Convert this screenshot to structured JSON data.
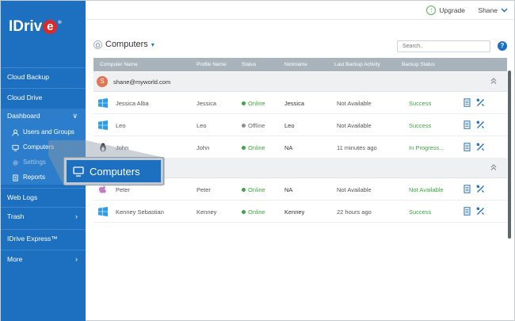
{
  "brand": {
    "logo_text": "IDriv",
    "logo_e": "e",
    "logo_mark": "®"
  },
  "topbar": {
    "upgrade_label": "Upgrade",
    "user_name": "Shane"
  },
  "sidebar": {
    "cloud_backup": "Cloud Backup",
    "cloud_drive": "Cloud Drive",
    "dashboard": "Dashboard",
    "dashboard_items": {
      "users": "Users and Groups",
      "computers": "Computers",
      "settings": "Settings",
      "reports": "Reports"
    },
    "web_logs": "Web Logs",
    "trash": "Trash",
    "express": "IDrive Express™",
    "more": "More"
  },
  "page": {
    "title": "Computers",
    "search_placeholder": "Search..",
    "help": "?"
  },
  "table": {
    "headers": {
      "computer": "Computer Name",
      "profile": "Profile Name",
      "status": "Status",
      "nickname": "Nickname",
      "last": "Last Backup Activity",
      "backup": "Backup Status"
    },
    "groups": [
      {
        "avatar": "S",
        "email": "shane@myworld.com"
      },
      {
        "avatar": "",
        "email": ""
      }
    ],
    "rows": [
      {
        "os": "windows",
        "name": "Jessica Alba",
        "profile": "Jessica",
        "status": "Online",
        "nickname": "Jessica",
        "last": "Not Available",
        "backup": "Success"
      },
      {
        "os": "windows",
        "name": "Leo",
        "profile": "Leo",
        "status": "Offline",
        "nickname": "Leo",
        "last": "Not Available",
        "backup": "Success"
      },
      {
        "os": "linux",
        "name": "John",
        "profile": "John",
        "status": "Online",
        "nickname": "NA",
        "last": "11 minutes ago",
        "backup": "In Progress..."
      },
      {
        "os": "mac",
        "name": "Peter",
        "profile": "Peter",
        "status": "Online",
        "nickname": "NA",
        "last": "Not Available",
        "backup": "Not Available"
      },
      {
        "os": "windows",
        "name": "Kenney Sebastian",
        "profile": "Kenney",
        "status": "Online",
        "nickname": "Kenney",
        "last": "22 hours ago",
        "backup": "Success"
      }
    ]
  },
  "tooltip": {
    "label": "Computers"
  },
  "colors": {
    "sidebar": "#1d6fbf",
    "online": "#3aa83f",
    "offline": "#8a8f94",
    "success": "#3aa83f",
    "header": "#a9b3bc"
  }
}
